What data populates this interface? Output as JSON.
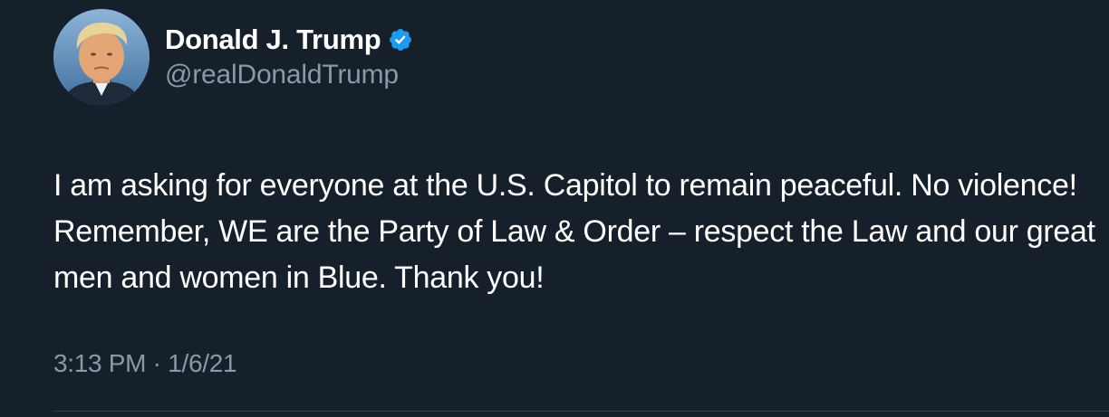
{
  "author": {
    "display_name": "Donald J. Trump",
    "handle": "@realDonaldTrump",
    "verified": true,
    "verified_color": "#1d9bf0",
    "avatar_icon": "profile-photo"
  },
  "tweet": {
    "text": "I am asking for everyone at the U.S. Capitol to remain peaceful. No violence! Remember, WE are the Party of Law & Order – respect the Law and our great men and women in Blue. Thank you!",
    "time": "3:13 PM",
    "separator": "·",
    "date": "1/6/21"
  },
  "theme": {
    "background": "#15202b",
    "text_primary": "#ffffff",
    "text_secondary": "#8b98a5",
    "divider": "#38444d"
  }
}
